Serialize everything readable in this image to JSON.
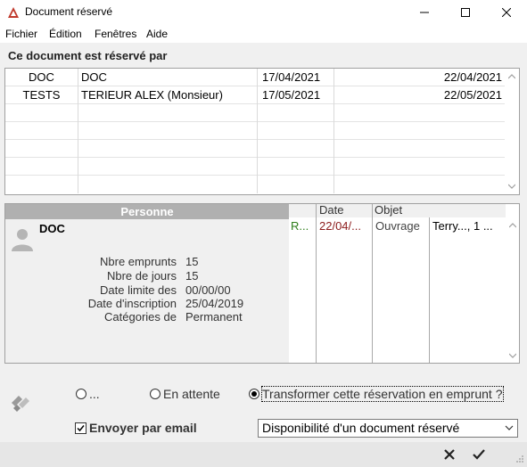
{
  "window": {
    "title": "Document réservé"
  },
  "menu": [
    "Fichier",
    "Édition",
    "Fenêtres",
    "Aide"
  ],
  "reservations": {
    "heading": "Ce document est réservé par",
    "rows": [
      {
        "code": "DOC",
        "name": "DOC",
        "date1": "17/04/2021",
        "date2": "22/04/2021"
      },
      {
        "code": "TESTS",
        "name": "TERIEUR ALEX (Monsieur)",
        "date1": "17/05/2021",
        "date2": "22/05/2021"
      }
    ]
  },
  "person": {
    "header": "Personne",
    "name": "DOC",
    "stats": [
      {
        "label": "Nbre emprunts",
        "value": "15"
      },
      {
        "label": "Nbre de jours",
        "value": "15"
      },
      {
        "label": "Date limite des",
        "value": "00/00/00"
      },
      {
        "label": "Date d'inscription",
        "value": "25/04/2019"
      },
      {
        "label": "Catégories de",
        "value": "Permanent"
      }
    ]
  },
  "loans": {
    "headers": {
      "date": "Date",
      "objet": "Objet"
    },
    "row": {
      "status": "R...",
      "date": "22/04/...",
      "type": "Ouvrage",
      "title": "Terry..., 1 ..."
    }
  },
  "options": {
    "radio1": "...",
    "radio2": "En attente",
    "radio3": "Transformer cette réservation en emprunt ?",
    "email_label": "Envoyer par email",
    "email_template": "Disponibilité d'un document réservé"
  },
  "colors": {
    "status_green": "#2e7d1a",
    "date_red": "#8b1a1a",
    "header_gray": "#b0b0b0"
  }
}
